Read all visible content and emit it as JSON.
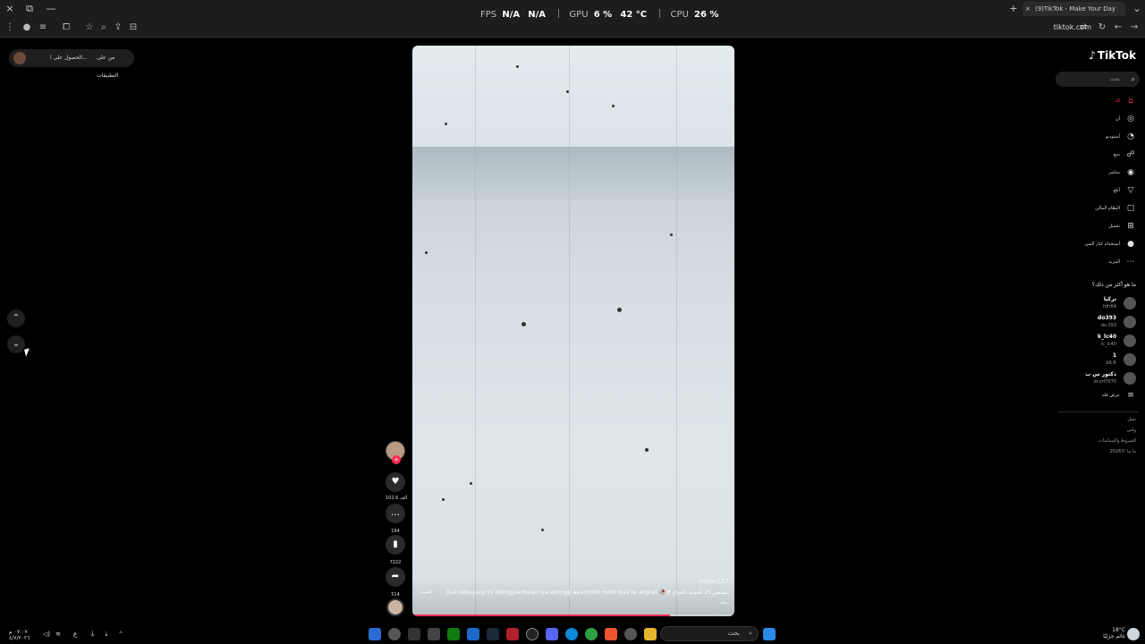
{
  "window": {
    "close_icon": "×",
    "restore_icon": "⧉",
    "minimize_icon": "—",
    "tab_title": "(9)TikTok - Make Your Day",
    "new_tab": "+",
    "tab_close": "×",
    "tab_menu": "⌄"
  },
  "perf_overlay": {
    "fps_label": "FPS",
    "fps_value1": "N/A",
    "fps_value2": "N/A",
    "gpu_label": "GPU",
    "gpu_usage": "6 %",
    "gpu_temp": "42 °C",
    "cpu_label": "CPU",
    "cpu_usage": "26 %"
  },
  "toolbar": {
    "url": "tiktok.com"
  },
  "notification": {
    "text1": "الحصول على ا...",
    "text2": "من على التطبيقات"
  },
  "video": {
    "username": "vsdan157",
    "caption": "Gak kebayang ini ketinggianbanjirnya setinggi apa mobil mobil bisa ke angkat 🥀 ديسمبر 25 أشجية تاسياح 6",
    "more": "المزيد",
    "music": "رحلة",
    "progress": 0.8
  },
  "actions": {
    "likes": "102.6 ألف",
    "comments": "194",
    "saves": "7222",
    "shares": "514"
  },
  "sidebar": {
    "logo": "TikTok",
    "search_placeholder": "بحث",
    "nav": [
      {
        "label": "لك",
        "icon": "⌂"
      },
      {
        "label": "أن",
        "icon": "◎"
      },
      {
        "label": "أستوديو",
        "icon": "◔"
      },
      {
        "label": "تتبع",
        "icon": "☍"
      },
      {
        "label": "مباشر",
        "icon": "◉"
      },
      {
        "label": "أبلغ",
        "icon": "▽"
      },
      {
        "label": "النظام المالي",
        "icon": "▢"
      },
      {
        "label": "تحميل",
        "icon": "⊞"
      },
      {
        "label": "أستخدام كبار السن",
        "icon": "●"
      },
      {
        "label": "المزيد",
        "icon": "⋯"
      }
    ],
    "following_title": "ما هو أكثر من ذلك؟",
    "accounts": [
      {
        "name": "تركيا",
        "handle": "fdfr64"
      },
      {
        "name": "do393",
        "handle": "do.393"
      },
      {
        "name": "k_lc40",
        "handle": "lc_lc40"
      },
      {
        "name": "1",
        "handle": "b6.ft"
      },
      {
        "name": "دكتور س ب",
        "handle": "dr.srf7070"
      }
    ],
    "see_more": "عرض قله",
    "footer": [
      "تسل",
      "ولس",
      "الشروط والسياسات",
      "2026© ما ما"
    ]
  },
  "taskbar": {
    "weather_temp": "18°C",
    "weather_desc": "غائم جزئيًا",
    "search": "بحث",
    "time": "٠٧:٠٧ م",
    "date": "٤/٧/٢٠٢٦",
    "lang": "ع"
  }
}
